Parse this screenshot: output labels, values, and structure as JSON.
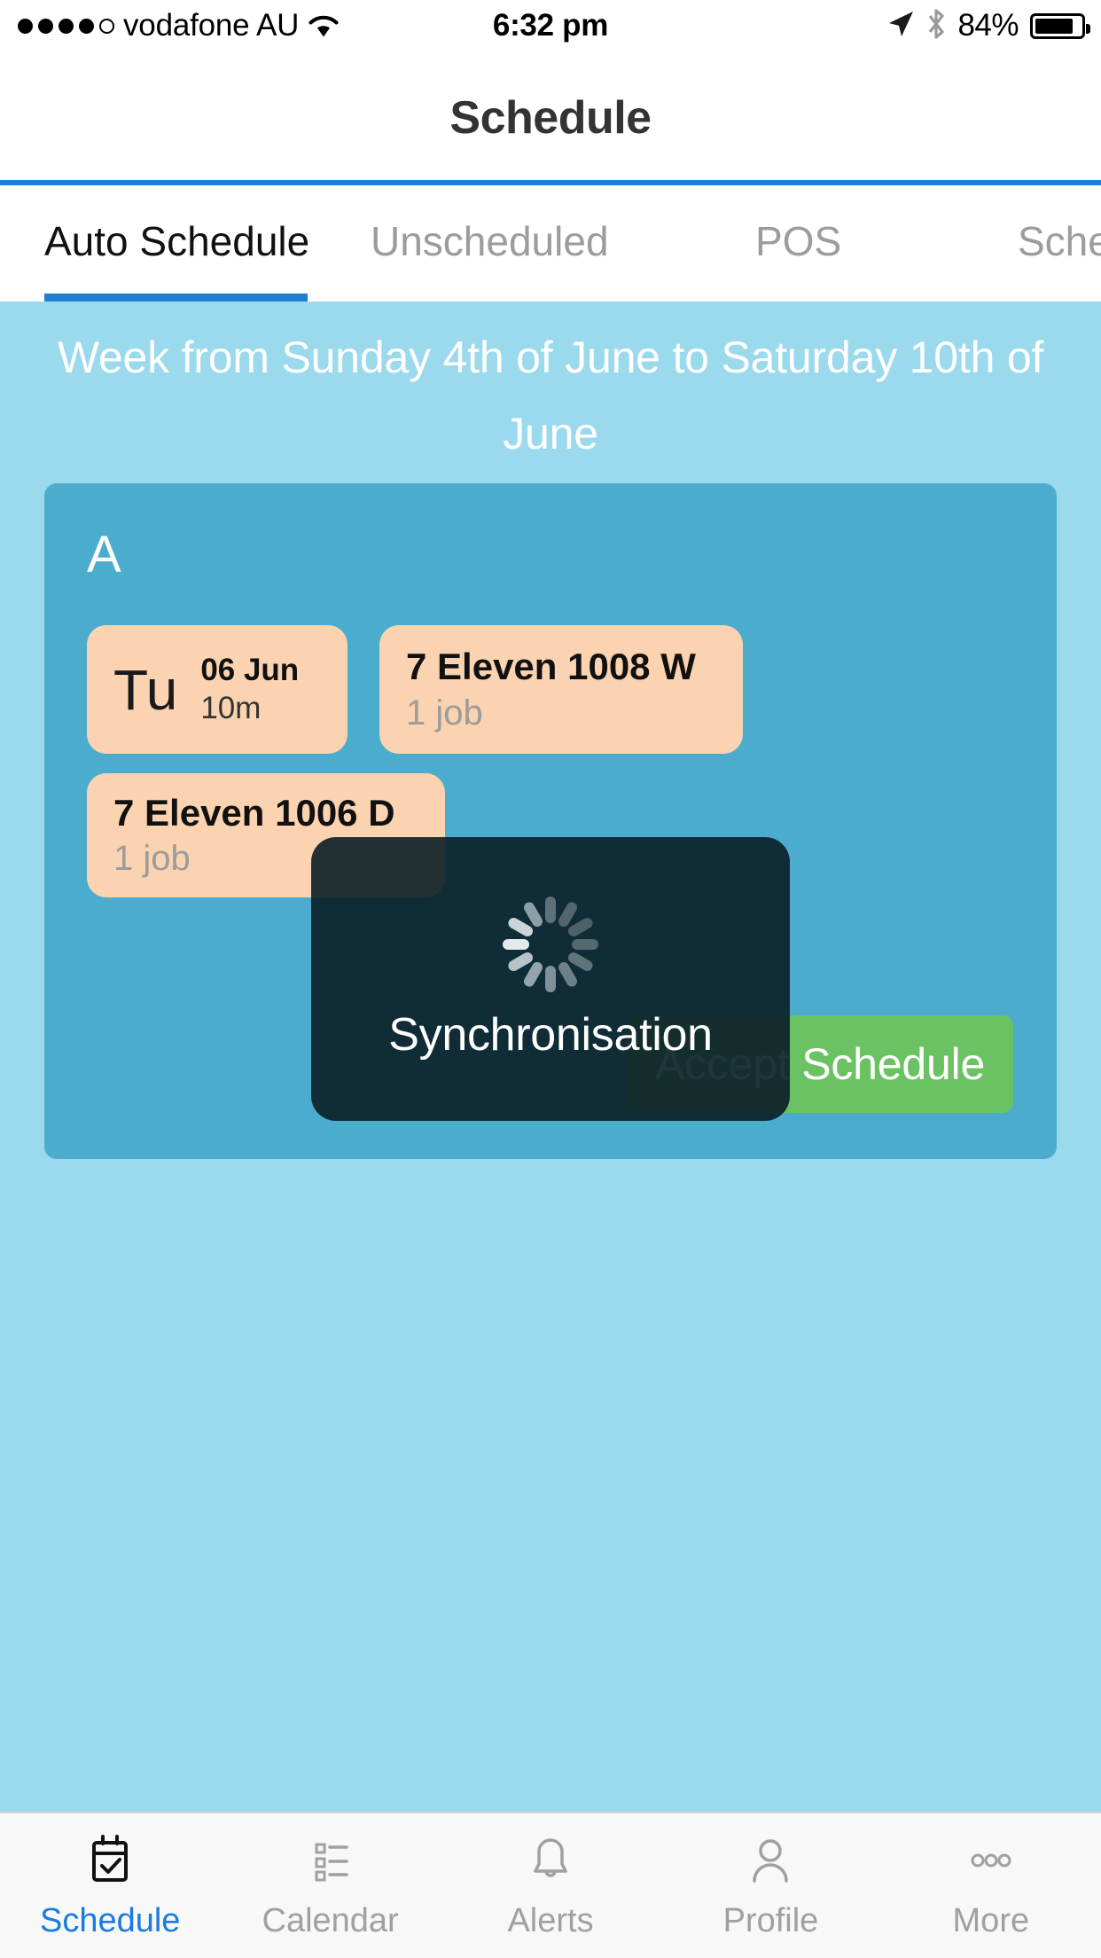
{
  "status_bar": {
    "signal_dots_filled": 4,
    "signal_dots_total": 5,
    "carrier": "vodafone AU",
    "wifi_icon": "wifi-icon",
    "time": "6:32 pm",
    "location_icon": "location-arrow-icon",
    "bluetooth_icon": "bluetooth-icon",
    "battery_percent": "84%",
    "battery_level": 84
  },
  "nav": {
    "title": "Schedule"
  },
  "segment_tabs": {
    "items": [
      {
        "label": "Auto Schedule",
        "active": true
      },
      {
        "label": "Unscheduled",
        "active": false
      },
      {
        "label": "POS",
        "active": false
      },
      {
        "label": "Sche",
        "active": false
      }
    ]
  },
  "week_header": {
    "text": "Week from Sunday 4th of June to Saturday 10th of June"
  },
  "schedule_card": {
    "group_label": "A",
    "day_pill": {
      "day_of_week": "Tu",
      "date": "06 Jun",
      "duration": "10m"
    },
    "jobs": [
      {
        "name": "7 Eleven 1008 W",
        "count": "1 job"
      },
      {
        "name": "7 Eleven 1006 D",
        "count": "1 job"
      }
    ],
    "accept_button": "Accept Schedule"
  },
  "sync_overlay": {
    "spinner_icon": "loading-spinner-icon",
    "label": "Synchronisation"
  },
  "bottom_tabs": {
    "items": [
      {
        "label": "Schedule",
        "icon": "calendar-check-icon",
        "active": true
      },
      {
        "label": "Calendar",
        "icon": "list-icon",
        "active": false
      },
      {
        "label": "Alerts",
        "icon": "bell-icon",
        "active": false
      },
      {
        "label": "Profile",
        "icon": "person-icon",
        "active": false
      },
      {
        "label": "More",
        "icon": "ellipsis-icon",
        "active": false
      }
    ]
  },
  "colors": {
    "page_background": "#9BD9EC",
    "card_background": "#4BACCE",
    "pill_background": "#FBD3B0",
    "accent_blue": "#1E7FD4",
    "accept_green": "#6BC263",
    "overlay_dark": "#0A1E26"
  }
}
